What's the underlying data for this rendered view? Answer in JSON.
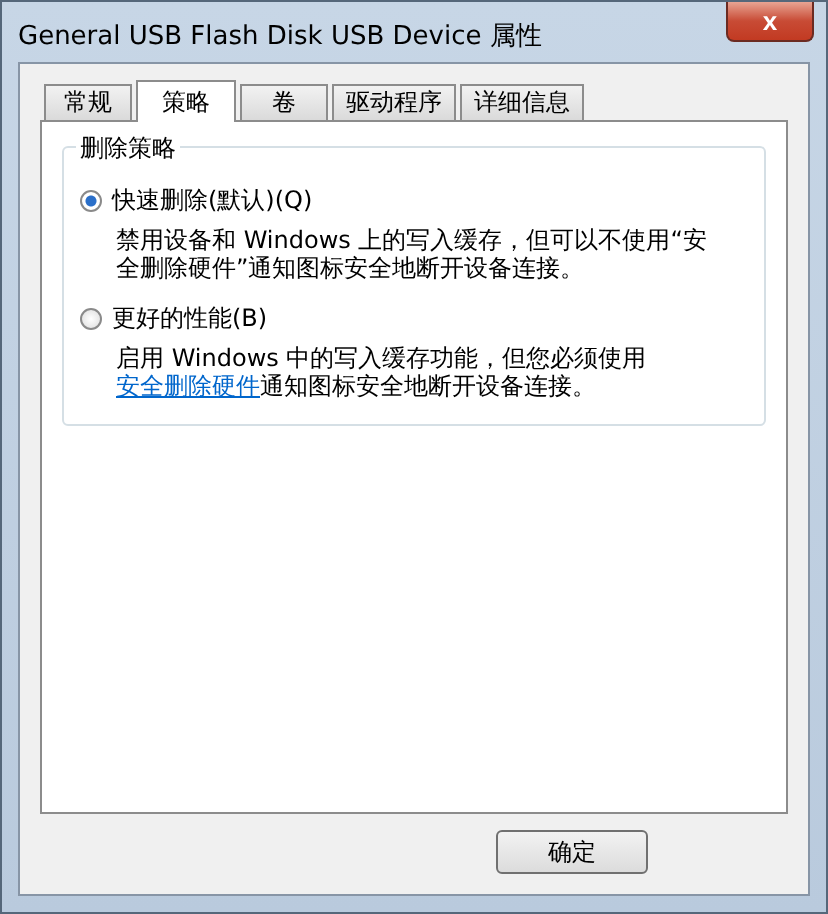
{
  "window": {
    "title": "General USB Flash Disk USB Device 属性",
    "close": "x"
  },
  "tabs": [
    {
      "label": "常规",
      "selected": false
    },
    {
      "label": "策略",
      "selected": true
    },
    {
      "label": "卷",
      "selected": false
    },
    {
      "label": "驱动程序",
      "selected": false
    },
    {
      "label": "详细信息",
      "selected": false
    }
  ],
  "group": {
    "title": "删除策略",
    "options": [
      {
        "label": "快速删除(默认)(Q)",
        "selected": true,
        "description": [
          {
            "kind": "text",
            "text": "禁用设备和 Windows 上的写入缓存，但可以不使用“安全删除硬件”通知图标安全地断开设备连接。"
          }
        ]
      },
      {
        "label": "更好的性能(B)",
        "selected": false,
        "description": [
          {
            "kind": "text",
            "text": "启用 Windows 中的写入缓存功能，但您必须使用"
          },
          {
            "kind": "link",
            "text": "安全删除硬件"
          },
          {
            "kind": "text",
            "text": "通知图标安全地断开设备连接。"
          }
        ]
      }
    ]
  },
  "buttons": [
    "确定"
  ]
}
